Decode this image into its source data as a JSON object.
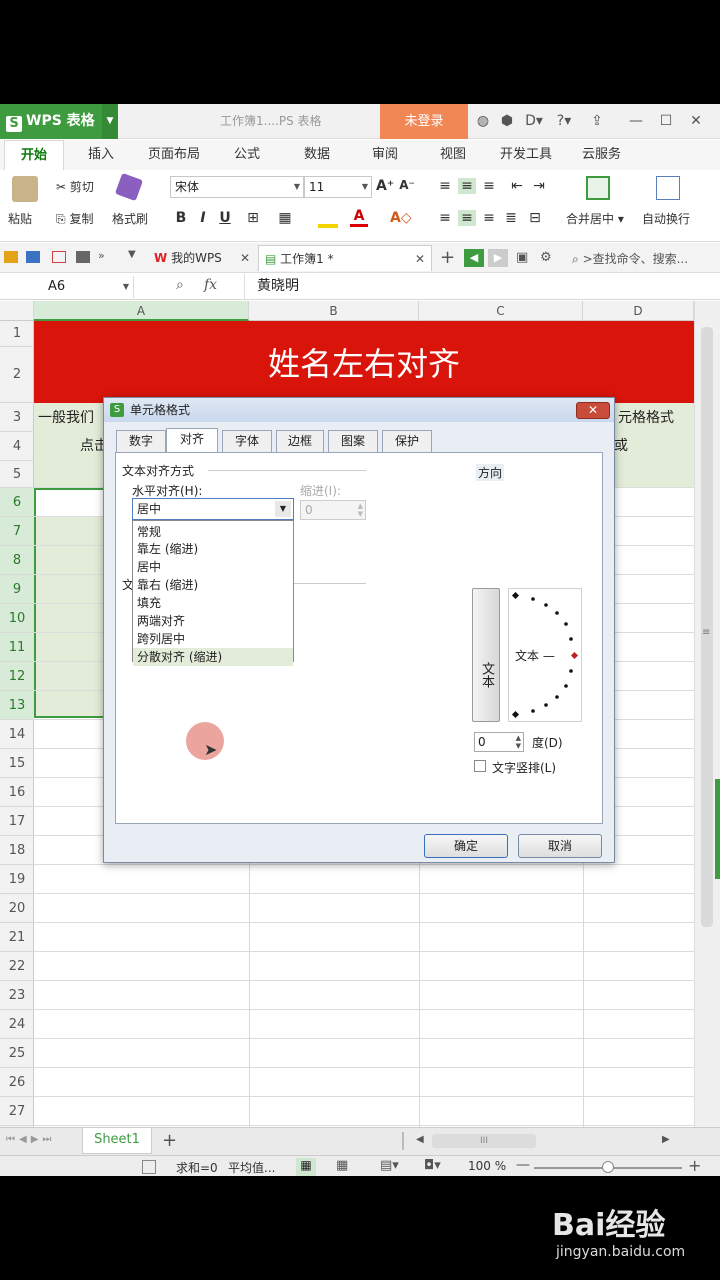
{
  "app": {
    "wps_label": "WPS 表格",
    "doc_title": "工作簿1....PS 表格",
    "login": "未登录"
  },
  "ribbon": {
    "tabs": [
      "开始",
      "插入",
      "页面布局",
      "公式",
      "数据",
      "审阅",
      "视图",
      "开发工具",
      "云服务"
    ],
    "paste": "粘贴",
    "cut": "剪切",
    "copy": "复制",
    "format_painter": "格式刷",
    "font_name": "宋体",
    "font_size": "11",
    "merge_center": "合并居中",
    "auto_wrap": "自动换行"
  },
  "quickbar": {
    "my_wps": "我的WPS",
    "workbook_tab": "工作簿1 *",
    "search": ">查找命令、搜索..."
  },
  "formula_bar": {
    "cell_ref": "A6",
    "fx": "fx",
    "content": "黄晓明"
  },
  "grid": {
    "columns": [
      "A",
      "B",
      "C",
      "D"
    ],
    "rows": [
      "1",
      "2",
      "3",
      "4",
      "5",
      "6",
      "7",
      "8",
      "9",
      "10",
      "11",
      "12",
      "13",
      "14",
      "15",
      "16",
      "17",
      "18",
      "19",
      "20",
      "21",
      "22",
      "23",
      "24",
      "25",
      "26",
      "27"
    ],
    "title_cell": "姓名左右对齐",
    "row3_left": "一般我们",
    "row4_left": "点击",
    "row3_right": "元格格式",
    "row4_right": "或"
  },
  "dialog": {
    "title": "单元格格式",
    "close": "✕",
    "tabs": [
      "数字",
      "对齐",
      "字体",
      "边框",
      "图案",
      "保护"
    ],
    "text_align_section": "文本对齐方式",
    "horizontal_label": "水平对齐(H):",
    "indent_label": "缩进(I):",
    "indent_value": "0",
    "selected_value": "居中",
    "options": [
      "常规",
      "靠左 (缩进)",
      "居中",
      "靠右 (缩进)",
      "填充",
      "两端对齐",
      "跨列居中",
      "分散对齐 (缩进)"
    ],
    "text_control_partial": "文",
    "direction_label": "方向",
    "vertical_text": "文本",
    "horizontal_text": "文本 —",
    "degree_value": "0",
    "degree_label": "度(D)",
    "vertical_stack_label": "文字竖排(L)",
    "ok": "确定",
    "cancel": "取消"
  },
  "sheet": {
    "tab": "Sheet1",
    "add": "+"
  },
  "status": {
    "sum": "求和=0",
    "avg": "平均值...",
    "zoom": "100 %"
  },
  "watermark": {
    "brand": "Bai经验",
    "url": "jingyan.baidu.com"
  },
  "colors": {
    "title_red": "#d9140b",
    "wps_green": "#3f9b3f",
    "login_orange": "#f08755",
    "selection_green": "#e3ecd8"
  }
}
